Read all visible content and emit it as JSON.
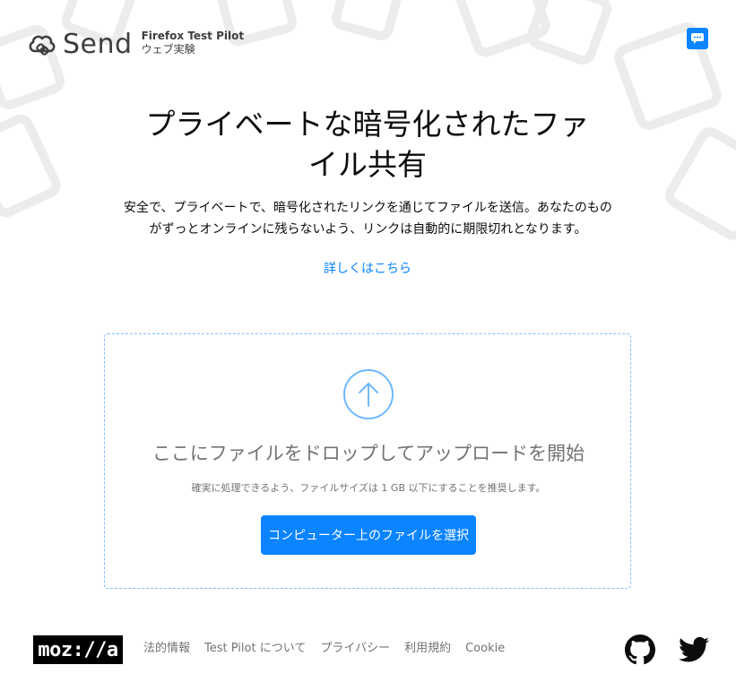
{
  "header": {
    "logo_text": "Send",
    "pilot_name": "Firefox Test Pilot",
    "pilot_sub": "ウェブ実験",
    "feedback_icon": "chat-bubble-icon"
  },
  "hero": {
    "title": "プライベートな暗号化されたファイル共有",
    "description": "安全で、プライベートで、暗号化されたリンクを通じてファイルを送信。あなたのものがずっとオンラインに残らないよう、リンクは自動的に期限切れとなります。",
    "learn_more": "詳しくはこちら"
  },
  "upload": {
    "icon": "upload-arrow-icon",
    "title": "ここにファイルをドロップしてアップロードを開始",
    "note": "確実に処理できるよう、ファイルサイズは 1 GB 以下にすることを推奨します。",
    "button_label": "コンピューター上のファイルを選択"
  },
  "footer": {
    "mozilla_logo": "moz://a",
    "links": [
      {
        "label": "法的情報"
      },
      {
        "label": "Test Pilot について"
      },
      {
        "label": "プライバシー"
      },
      {
        "label": "利用規約"
      },
      {
        "label": "Cookie"
      }
    ],
    "github_icon": "github-icon",
    "twitter_icon": "twitter-icon"
  },
  "colors": {
    "accent": "#0a84ff",
    "text": "#0c0c0d",
    "muted": "#737373"
  }
}
